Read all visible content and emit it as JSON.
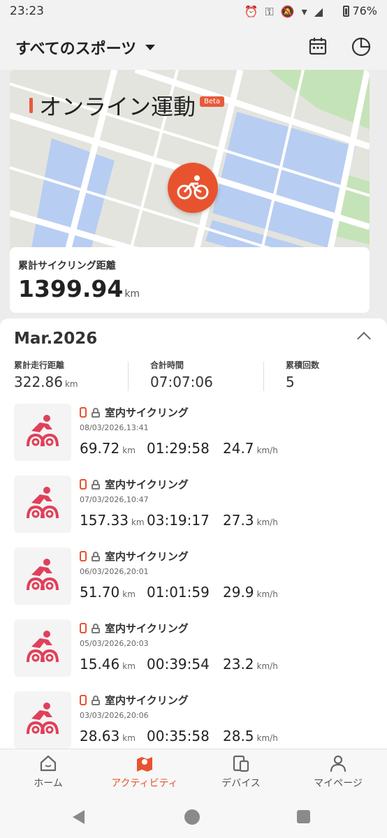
{
  "status_bar": {
    "time": "23:23",
    "battery": "76%",
    "icons": [
      "alarm-icon",
      "vpn-key-icon",
      "mute-icon",
      "wifi-icon",
      "signal-icon"
    ]
  },
  "header": {
    "title": "すべてのスポーツ",
    "calendar_icon": "calendar-icon",
    "stats_icon": "pie-chart-icon"
  },
  "online": {
    "title": "オンライン運動",
    "badge": "Beta",
    "cumulative_label": "累計サイクリング距離",
    "cumulative_value": "1399.94",
    "cumulative_unit": "km"
  },
  "month": {
    "title": "Mar.2026",
    "summary": [
      {
        "label": "累計走行距離",
        "value": "322.86",
        "unit": "km"
      },
      {
        "label": "合計時間",
        "value": "07:07:06",
        "unit": ""
      },
      {
        "label": "累積回数",
        "value": "5",
        "unit": ""
      }
    ]
  },
  "activities": [
    {
      "name": "室内サイクリング",
      "date": "08/03/2026,13:41",
      "distance": "69.72",
      "duration": "01:29:58",
      "speed": "24.7"
    },
    {
      "name": "室内サイクリング",
      "date": "07/03/2026,10:47",
      "distance": "157.33",
      "duration": "03:19:17",
      "speed": "27.3"
    },
    {
      "name": "室内サイクリング",
      "date": "06/03/2026,20:01",
      "distance": "51.70",
      "duration": "01:01:59",
      "speed": "29.9"
    },
    {
      "name": "室内サイクリング",
      "date": "05/03/2026,20:03",
      "distance": "15.46",
      "duration": "00:39:54",
      "speed": "23.2"
    },
    {
      "name": "室内サイクリング",
      "date": "03/03/2026,20:06",
      "distance": "28.63",
      "duration": "00:35:58",
      "speed": "28.5"
    }
  ],
  "units": {
    "distance": "km",
    "speed": "km/h"
  },
  "bottom_nav": [
    {
      "label": "ホーム",
      "icon": "home-icon",
      "active": false
    },
    {
      "label": "アクティビティ",
      "icon": "activity-icon",
      "active": true
    },
    {
      "label": "デバイス",
      "icon": "device-icon",
      "active": false
    },
    {
      "label": "マイページ",
      "icon": "person-icon",
      "active": false
    }
  ],
  "colors": {
    "accent": "#e8532f",
    "bike_icon": "#e0405a"
  }
}
